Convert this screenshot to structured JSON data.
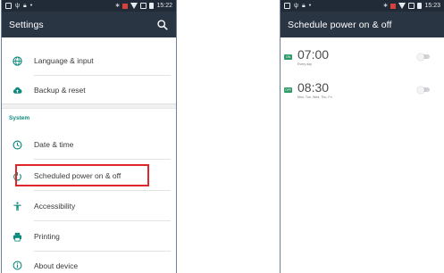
{
  "left_screen": {
    "status_time": "15:22",
    "title": "Settings",
    "items_top": [
      {
        "label": "Language & input",
        "icon": "globe-icon"
      },
      {
        "label": "Backup & reset",
        "icon": "cloud-upload-icon"
      }
    ],
    "section_header": "System",
    "items_system": [
      {
        "label": "Date & time",
        "icon": "clock-icon"
      },
      {
        "label": "Scheduled power on & off",
        "icon": "power-clock-icon"
      },
      {
        "label": "Accessibility",
        "icon": "accessibility-icon"
      },
      {
        "label": "Printing",
        "icon": "printer-icon"
      },
      {
        "label": "About device",
        "icon": "info-icon"
      }
    ]
  },
  "right_screen": {
    "status_time": "15:23",
    "title": "Schedule power on & off",
    "schedules": [
      {
        "badge": "ON",
        "time": "07:00",
        "days": "Every day",
        "enabled": false
      },
      {
        "badge": "OFF",
        "time": "08:30",
        "days": "Mon, Tue, Wed, Thu, Fri",
        "enabled": false
      }
    ]
  },
  "colors": {
    "app_bar": "#2a3544",
    "status_bar": "#212b38",
    "accent_teal": "#0f8a7e",
    "highlight_red": "#e0262a",
    "badge_green": "#2e9b67"
  }
}
